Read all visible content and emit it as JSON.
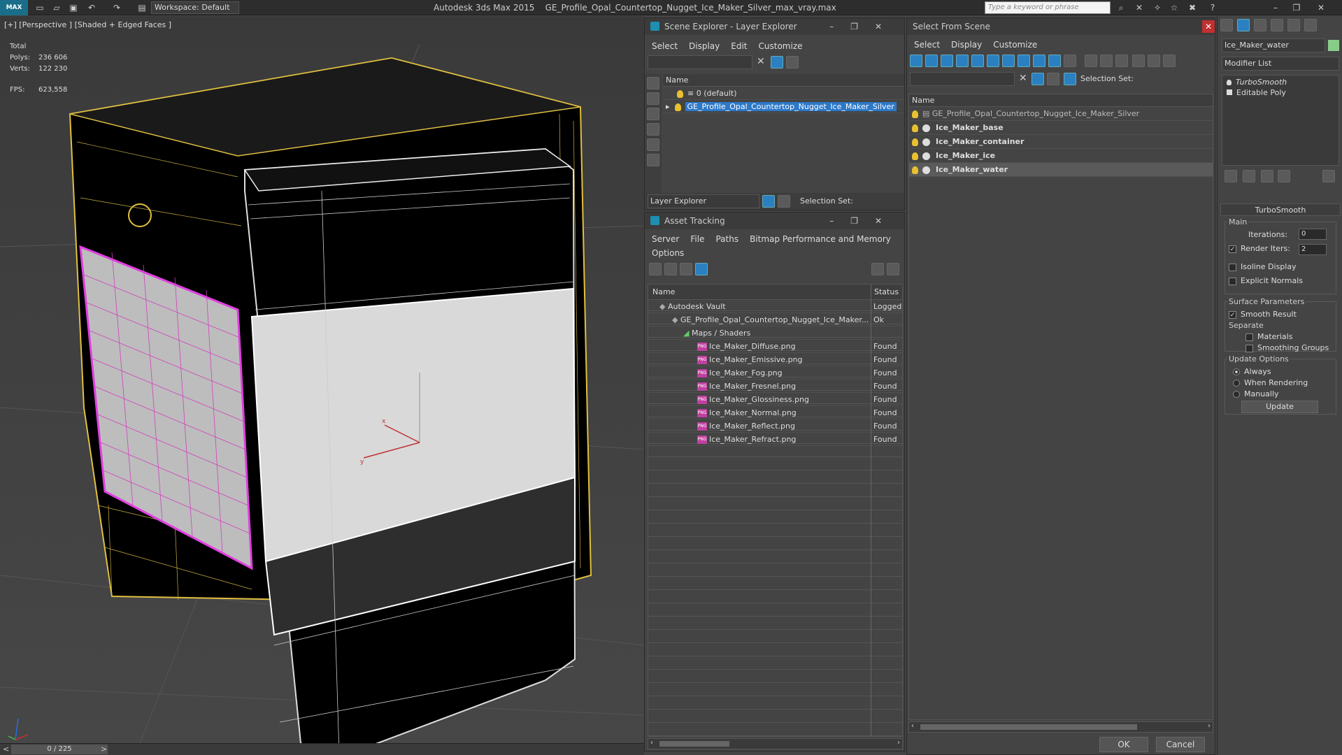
{
  "titlebar": {
    "logo": "MAX",
    "workspace": "Workspace: Default",
    "app_name": "Autodesk 3ds Max  2015",
    "filename": "GE_Profile_Opal_Countertop_Nugget_Ice_Maker_Silver_max_vray.max",
    "search_placeholder": "Type a keyword or phrase"
  },
  "viewport": {
    "label": "[+] [Perspective ] [Shaded + Edged Faces ]",
    "stats_total": "Total",
    "polys_label": "Polys:",
    "polys_value": "236 606",
    "verts_label": "Verts:",
    "verts_value": "122 230",
    "fps_label": "FPS:",
    "fps_value": "623,558",
    "axis_x": "x",
    "axis_y": "y",
    "axis_z": "z",
    "timeline": "0 / 225"
  },
  "scene_explorer": {
    "title": "Scene Explorer - Layer Explorer",
    "menu": [
      "Select",
      "Display",
      "Edit",
      "Customize"
    ],
    "col_name": "Name",
    "rows": [
      "0 (default)",
      "GE_Profile_Opal_Countertop_Nugget_Ice_Maker_Silver"
    ],
    "footer_label": "Layer Explorer",
    "selection_set": "Selection Set:"
  },
  "asset_tracking": {
    "title": "Asset Tracking",
    "menu": [
      "Server",
      "File",
      "Paths",
      "Bitmap Performance and Memory"
    ],
    "menu2": "Options",
    "col_name": "Name",
    "col_status": "Status",
    "rows": [
      {
        "name": "Autodesk Vault",
        "status": "Logged"
      },
      {
        "name": "GE_Profile_Opal_Countertop_Nugget_Ice_Maker...",
        "status": "Ok"
      },
      {
        "name": "Maps / Shaders",
        "status": ""
      },
      {
        "name": "Ice_Maker_Diffuse.png",
        "status": "Found"
      },
      {
        "name": "Ice_Maker_Emissive.png",
        "status": "Found"
      },
      {
        "name": "Ice_Maker_Fog.png",
        "status": "Found"
      },
      {
        "name": "Ice_Maker_Fresnel.png",
        "status": "Found"
      },
      {
        "name": "Ice_Maker_Glossiness.png",
        "status": "Found"
      },
      {
        "name": "Ice_Maker_Normal.png",
        "status": "Found"
      },
      {
        "name": "Ice_Maker_Reflect.png",
        "status": "Found"
      },
      {
        "name": "Ice_Maker_Refract.png",
        "status": "Found"
      }
    ],
    "png_badge": "PNG"
  },
  "select_from_scene": {
    "title": "Select From Scene",
    "menu": [
      "Select",
      "Display",
      "Customize"
    ],
    "selection_set": "Selection Set:",
    "col_name": "Name",
    "rows": [
      "GE_Profile_Opal_Countertop_Nugget_Ice_Maker_Silver",
      "Ice_Maker_base",
      "Ice_Maker_container",
      "Ice_Maker_ice",
      "Ice_Maker_water"
    ],
    "ok": "OK",
    "cancel": "Cancel"
  },
  "modify_panel": {
    "object_name": "Ice_Maker_water",
    "modifier_list": "Modifier List",
    "stack": [
      "TurboSmooth",
      "Editable Poly"
    ],
    "rollout_title": "TurboSmooth",
    "main_label": "Main",
    "iterations_label": "Iterations:",
    "iterations_value": "0",
    "render_iters_label": "Render Iters:",
    "render_iters_value": "2",
    "isoline": "Isoline Display",
    "explicit_normals": "Explicit Normals",
    "surface_params": "Surface Parameters",
    "smooth_result": "Smooth Result",
    "separate": "Separate",
    "materials": "Materials",
    "smoothing_groups": "Smoothing Groups",
    "update_options": "Update Options",
    "always": "Always",
    "when_rendering": "When Rendering",
    "manually": "Manually",
    "update_btn": "Update",
    "check": "✓"
  }
}
